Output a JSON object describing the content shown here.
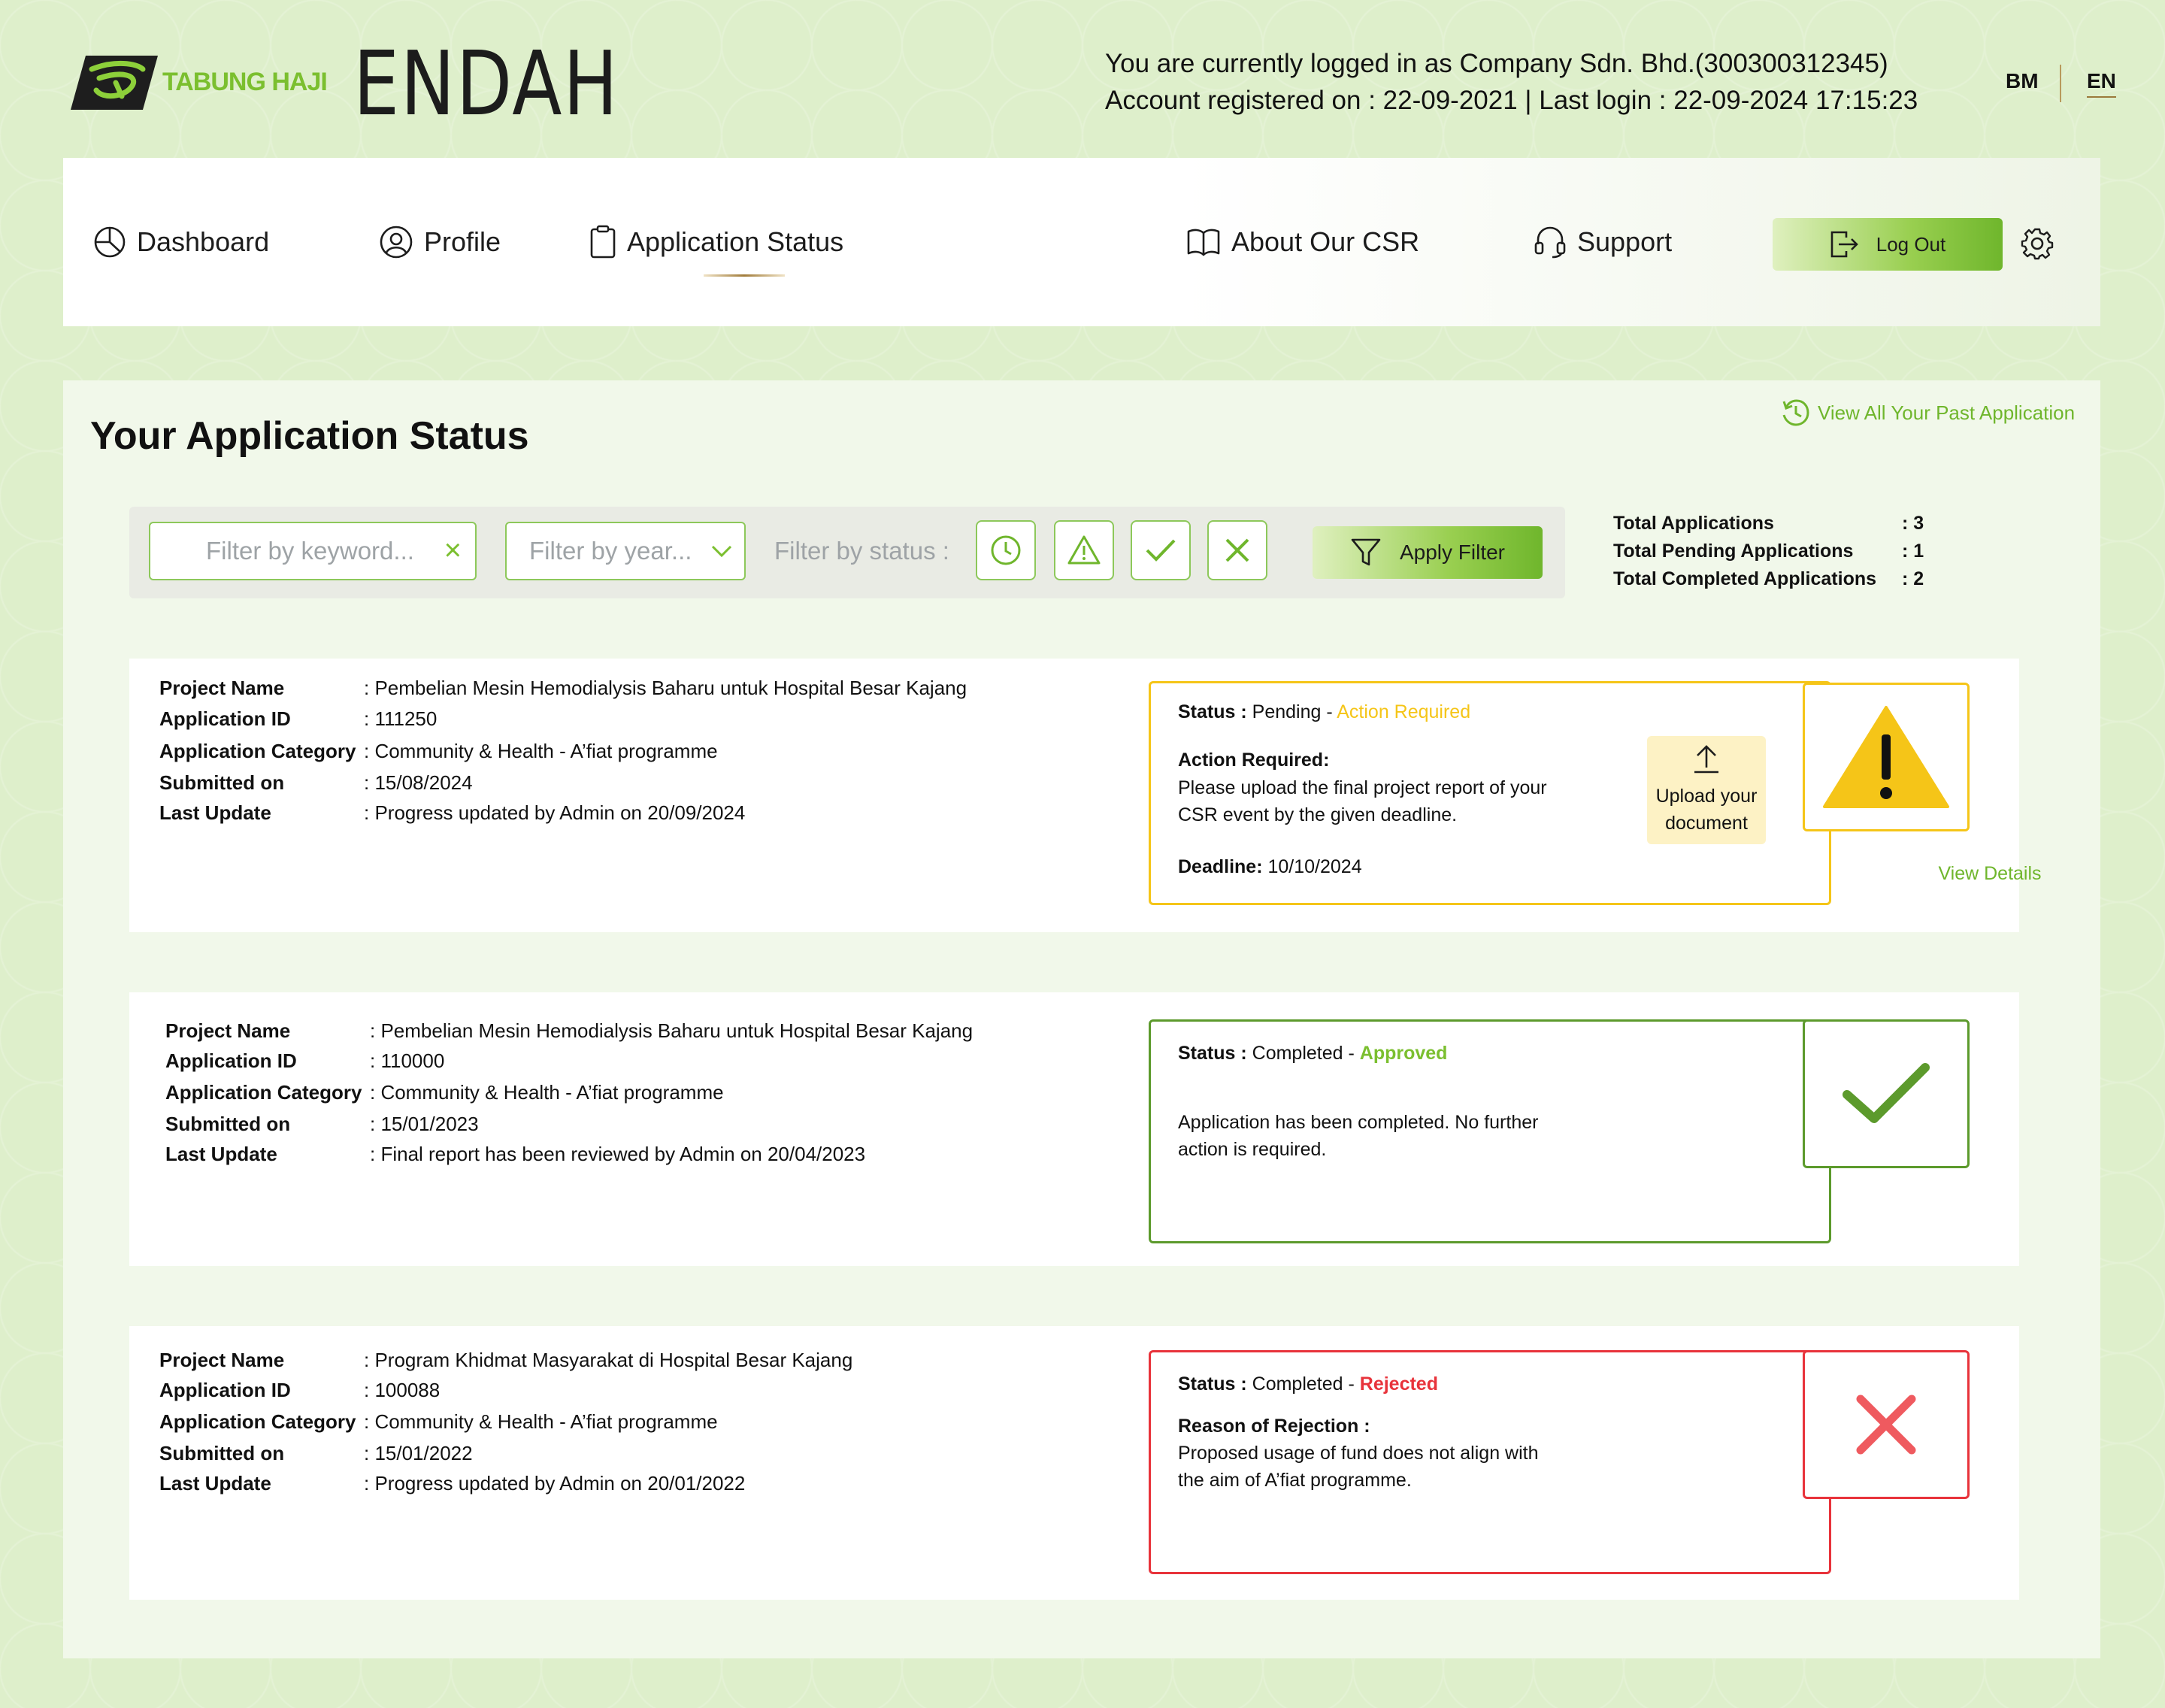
{
  "header": {
    "logo_text": "TABUNG HAJI",
    "brand": "ENDAH",
    "login_line1": "You are currently logged in as Company Sdn. Bhd.(300300312345)",
    "login_line2": "Account registered on : 22-09-2021 | Last login : 22-09-2024 17:15:23",
    "lang_bm": "BM",
    "lang_en": "EN"
  },
  "nav": {
    "dashboard": "Dashboard",
    "profile": "Profile",
    "application_status": "Application Status",
    "about": "About Our CSR",
    "support": "Support",
    "logout": "Log Out"
  },
  "page": {
    "title": "Your Application Status",
    "past_link": "View All Your Past Application"
  },
  "filters": {
    "keyword_placeholder": "Filter by keyword...",
    "year_placeholder": "Filter by year...",
    "status_label": "Filter by status :",
    "apply": "Apply Filter"
  },
  "totals": [
    {
      "label": "Total Applications",
      "value": ": 3"
    },
    {
      "label": "Total Pending Applications",
      "value": ": 1"
    },
    {
      "label": "Total Completed Applications",
      "value": ": 2"
    }
  ],
  "labels": {
    "project_name": "Project Name",
    "application_id": "Application ID",
    "application_category": "Application Category",
    "submitted_on": "Submitted on",
    "last_update": "Last Update",
    "status": "Status :",
    "view_details": "View Details"
  },
  "applications": [
    {
      "project_name": ": Pembelian Mesin Hemodialysis Baharu untuk Hospital Besar Kajang",
      "application_id": ": 111250",
      "category": ": Community & Health - A’fiat programme",
      "submitted_on": ": 15/08/2024",
      "last_update": ": Progress updated by Admin on 20/09/2024",
      "status_main": "Pending - ",
      "status_sub": "Action Required",
      "note_title": "Action Required:",
      "note_line1": "Please upload the final project report of your",
      "note_line2": "CSR event by the given deadline.",
      "deadline_label": "Deadline:",
      "deadline_value": "10/10/2024",
      "upload_line1": "Upload your",
      "upload_line2": "document",
      "color": "#f5c518"
    },
    {
      "project_name": ": Pembelian Mesin Hemodialysis Baharu untuk Hospital Besar Kajang",
      "application_id": ": 110000",
      "category": ": Community & Health - A’fiat programme",
      "submitted_on": ": 15/01/2023",
      "last_update": ": Final report has been reviewed by Admin on 20/04/2023",
      "status_main": "Completed - ",
      "status_sub": "Approved",
      "note_line1": "Application has been completed. No further",
      "note_line2": "action is required.",
      "color": "#5c9a2c"
    },
    {
      "project_name": ": Program Khidmat Masyarakat di Hospital Besar Kajang",
      "application_id": ": 100088",
      "category": ": Community & Health - A’fiat programme",
      "submitted_on": ": 15/01/2022",
      "last_update": ": Progress updated by Admin on 20/01/2022",
      "status_main": "Completed - ",
      "status_sub": "Rejected",
      "note_title": "Reason of Rejection :",
      "note_line1": "Proposed usage of fund does not align with",
      "note_line2": "the aim of A’fiat programme.",
      "color": "#e8333b"
    }
  ],
  "colors": {
    "accent_green": "#6fb62c",
    "pending_yellow": "#f5c518",
    "approved_green": "#5c9a2c",
    "rejected_red": "#e8333b"
  }
}
